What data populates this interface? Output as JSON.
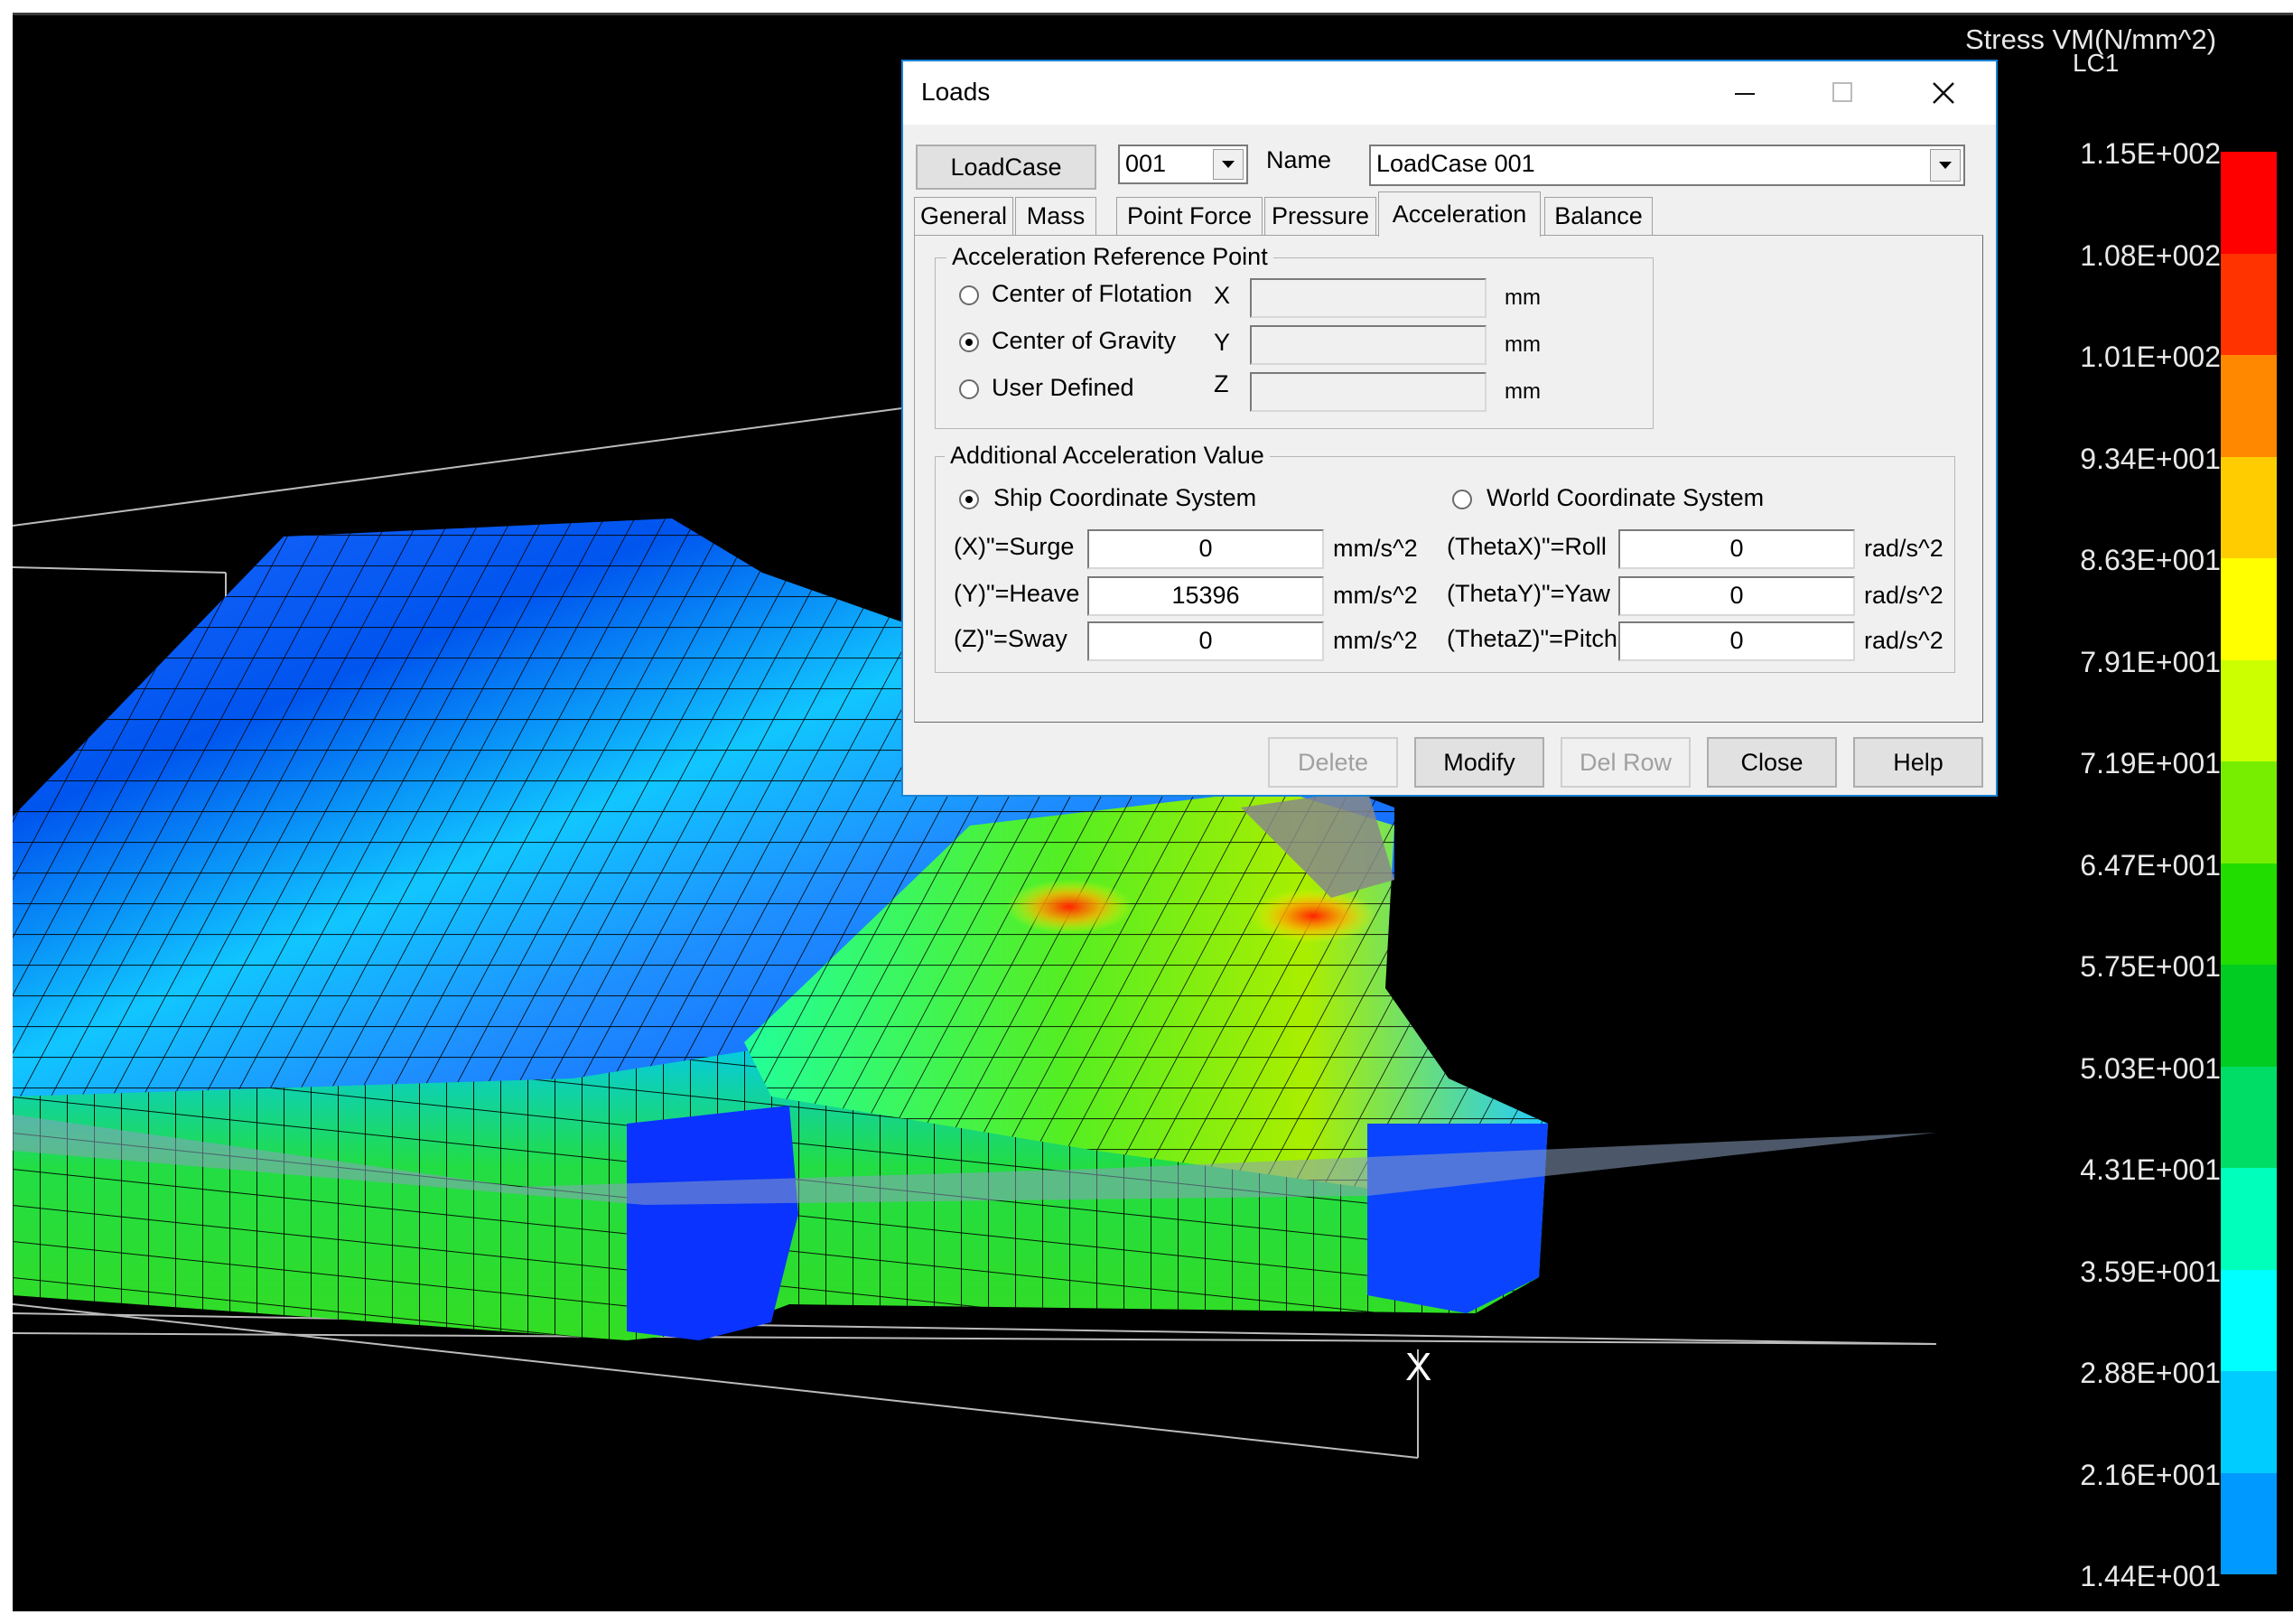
{
  "legend": {
    "title": "Stress VM(N/mm^2)",
    "subtitle": "LC1",
    "values": [
      "1.15E+002",
      "1.08E+002",
      "1.01E+002",
      "9.34E+001",
      "8.63E+001",
      "7.91E+001",
      "7.19E+001",
      "6.47E+001",
      "5.75E+001",
      "5.03E+001",
      "4.31E+001",
      "3.59E+001",
      "2.88E+001",
      "2.16E+001",
      "1.44E+001"
    ],
    "colors": [
      "#ff0000",
      "#ff3300",
      "#ff8800",
      "#ffcc00",
      "#ffff00",
      "#ccff00",
      "#77ee00",
      "#22dd00",
      "#00cc22",
      "#00dd66",
      "#00ffbb",
      "#00ffff",
      "#00ccff",
      "#0099ff",
      "#0066ff",
      "#0033ff"
    ]
  },
  "axis_label": "X",
  "dialog": {
    "title": "Loads",
    "loadcase_button": "LoadCase",
    "loadcase_number": "001",
    "name_label": "Name",
    "name_value": "LoadCase 001",
    "tabs": [
      "General",
      "Mass",
      "Point Force",
      "Pressure",
      "Acceleration",
      "Balance"
    ],
    "active_tab": "Acceleration",
    "ref_group": {
      "title": "Acceleration Reference Point",
      "options": [
        "Center of Flotation",
        "Center of Gravity",
        "User Defined"
      ],
      "selected": "Center of Gravity",
      "coord_labels": [
        "X",
        "Y",
        "Z"
      ],
      "unit": "mm"
    },
    "accel_group": {
      "title": "Additional Acceleration Value",
      "ship_option": "Ship Coordinate System",
      "world_option": "World Coordinate System",
      "selected": "Ship Coordinate System",
      "linear": [
        {
          "label": "(X)\"=Surge",
          "value": "0",
          "unit": "mm/s^2"
        },
        {
          "label": "(Y)\"=Heave",
          "value": "15396",
          "unit": "mm/s^2"
        },
        {
          "label": "(Z)\"=Sway",
          "value": "0",
          "unit": "mm/s^2"
        }
      ],
      "angular": [
        {
          "label": "(ThetaX)\"=Roll",
          "value": "0",
          "unit": "rad/s^2"
        },
        {
          "label": "(ThetaY)\"=Yaw",
          "value": "0",
          "unit": "rad/s^2"
        },
        {
          "label": "(ThetaZ)\"=Pitch",
          "value": "0",
          "unit": "rad/s^2"
        }
      ]
    },
    "buttons": {
      "delete": "Delete",
      "modify": "Modify",
      "del_row": "Del Row",
      "close": "Close",
      "help": "Help"
    }
  }
}
